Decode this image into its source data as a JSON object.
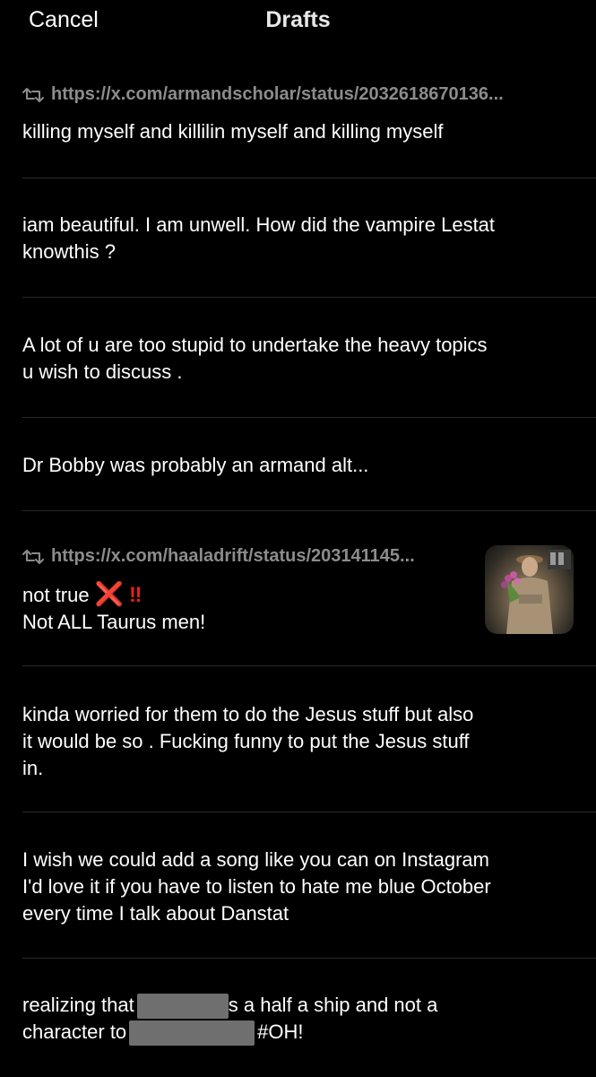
{
  "header": {
    "cancel_label": "Cancel",
    "title": "Drafts"
  },
  "drafts": [
    {
      "quote_url": "https://x.com/armandscholar/status/2032618670136...",
      "lines": [
        "killing myself and killilin myself and killing myself"
      ]
    },
    {
      "lines": [
        "iam beautiful. I am unwell. How did the vampire Lestat",
        "knowthis ?"
      ]
    },
    {
      "lines": [
        "A lot of u are too stupid to undertake the heavy topics",
        "u wish to discuss ."
      ]
    },
    {
      "lines": [
        "Dr Bobby was probably an armand alt..."
      ]
    },
    {
      "quote_url": "https://x.com/haaladrift/status/203141145...",
      "lines": [
        "not true",
        "Not ALL Taurus men!"
      ],
      "emoji_x": "❌",
      "emoji_bang": "‼",
      "has_thumbnail": true
    },
    {
      "lines": [
        "kinda worried for them to do the Jesus stuff but also",
        "it would be so . Fucking funny to put the Jesus stuff",
        "in."
      ]
    },
    {
      "lines": [
        "I wish we could add a song like you can on Instagram",
        "I'd love it if you have to listen to hate me blue October",
        "every time I talk about Danstat"
      ]
    },
    {
      "line1_before": "realizing that",
      "line1_after": "s a half a ship and not a",
      "line2_before": "character to",
      "line2_after": "#OH!"
    }
  ],
  "icons": {
    "retweet": "retweet-icon",
    "redaction": "redaction-block"
  },
  "colors": {
    "background": "#000000",
    "text": "#ffffff",
    "muted": "#8c8c8c",
    "divider": "#2a2a2a",
    "emoji_red": "#e0211f",
    "redaction": "#6f6f6f"
  }
}
